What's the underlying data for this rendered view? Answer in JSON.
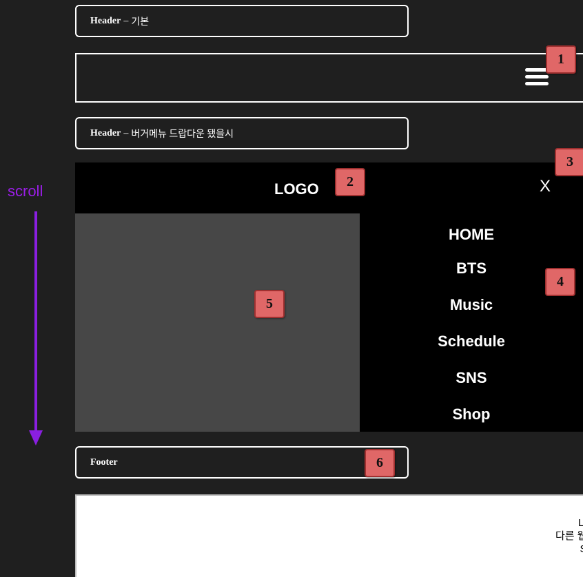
{
  "labels": {
    "header_basic": {
      "title": "Header",
      "sep": "–",
      "desc": "기본"
    },
    "header_dropdown": {
      "title": "Header",
      "sep": "–",
      "desc": "버거메뉴 드랍다운 됐을시"
    },
    "footer": {
      "title": "Footer"
    }
  },
  "badges": [
    "1",
    "2",
    "3",
    "4",
    "5",
    "6"
  ],
  "header": {
    "menu_icon": "hamburger-menu-icon"
  },
  "dropdown": {
    "logo": "LOGO",
    "close": "X",
    "nav_items": [
      "HOME",
      "BTS",
      "Music",
      "Schedule",
      "SNS",
      "Shop"
    ]
  },
  "scroll": {
    "label": "scroll"
  },
  "footer_content": {
    "lines": [
      "LI",
      "다른 웹",
      "S"
    ]
  },
  "colors": {
    "background": "#1f1f1f",
    "badge": "#e06767",
    "scroll_accent": "#8a1fe0",
    "image_placeholder": "#474747"
  }
}
